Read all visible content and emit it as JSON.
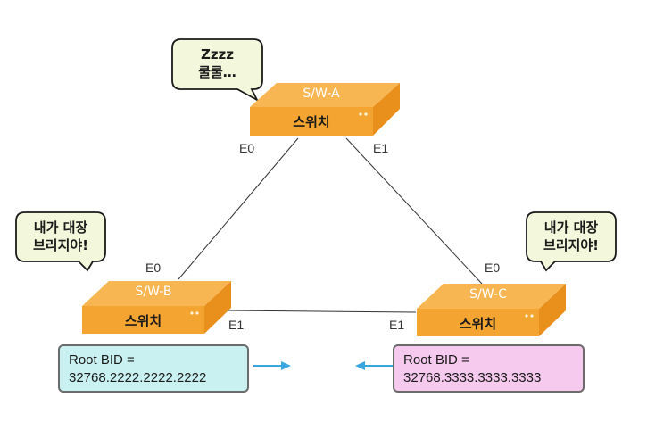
{
  "switches": {
    "a": {
      "name": "S/W-A",
      "label": "스위치"
    },
    "b": {
      "name": "S/W-B",
      "label": "스위치"
    },
    "c": {
      "name": "S/W-C",
      "label": "스위치"
    }
  },
  "ports": {
    "a_left": "E0",
    "a_right": "E1",
    "b_top": "E0",
    "b_right": "E1",
    "c_top": "E0",
    "c_left": "E1"
  },
  "bubbles": {
    "a": {
      "line1": "Zzzz",
      "line2": "쿨쿨…"
    },
    "b": {
      "line1": "내가 대장",
      "line2": "브리지야!"
    },
    "c": {
      "line1": "내가 대장",
      "line2": "브리지야!"
    }
  },
  "bid_boxes": {
    "b": {
      "line1": "Root BID =",
      "line2": "32768.2222.2222.2222"
    },
    "c": {
      "line1": "Root BID =",
      "line2": "32768.3333.3333.3333"
    }
  },
  "colors": {
    "switch_top": "#f8b653",
    "switch_front": "#f4a431",
    "switch_side": "#e88f1c",
    "bubble_fill": "#f3f8dc",
    "bid_b_fill": "#c9f1f1",
    "bid_c_fill": "#f6c9ee",
    "arrow": "#3aa6e0",
    "link": "#333333"
  }
}
